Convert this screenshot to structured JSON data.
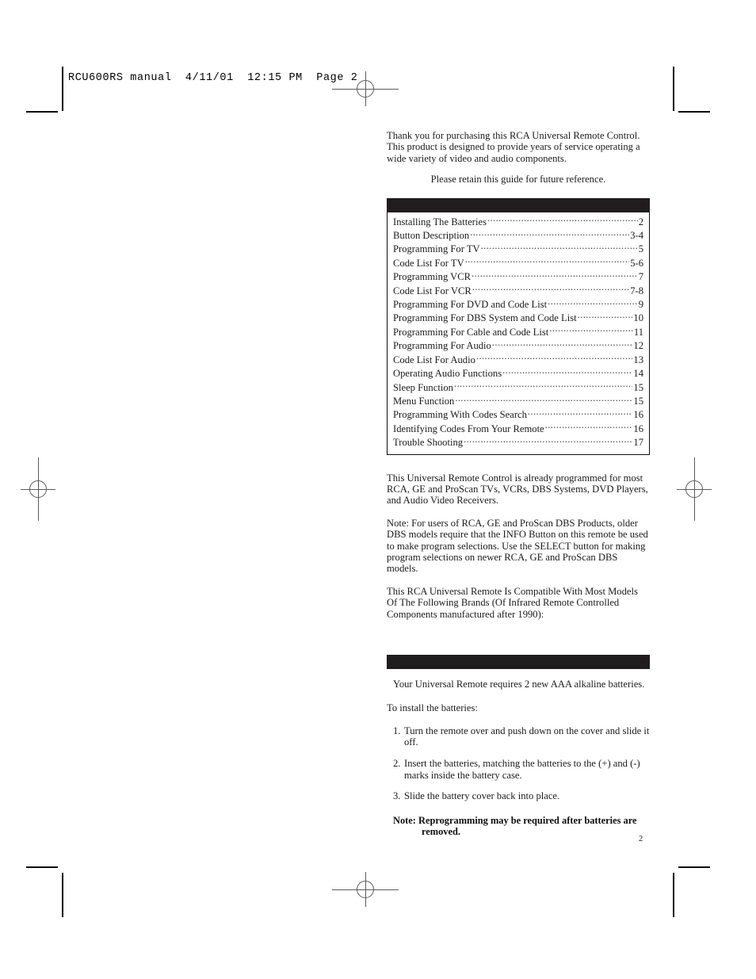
{
  "printer_slug": "RCU600RS manual  4/11/01  12:15 PM  Page 2",
  "intro": {
    "paragraph": "Thank you for purchasing this RCA Universal Remote Control. This product is designed to provide years of service operating a wide variety of video and audio components.",
    "retain_note": "Please retain this guide for future reference."
  },
  "contents": {
    "banner_label": "",
    "entries": [
      {
        "label": "Installing The Batteries",
        "page": "2"
      },
      {
        "label": "Button Description ",
        "page": "3-4"
      },
      {
        "label": "Programming For TV ",
        "page": "5"
      },
      {
        "label": "Code List For TV ",
        "page": "5-6"
      },
      {
        "label": "Programming VCR  ",
        "page": "7"
      },
      {
        "label": "Code List For VCR  ",
        "page": "7-8"
      },
      {
        "label": "Programming For DVD and Code List ",
        "page": "9"
      },
      {
        "label": "Programming For DBS System and Code List",
        "page": "10"
      },
      {
        "label": "Programming For Cable and Code List",
        "page": "11"
      },
      {
        "label": "Programming For Audio ",
        "page": "12"
      },
      {
        "label": "Code List For Audio",
        "page": "13"
      },
      {
        "label": "Operating Audio Functions",
        "page": "14"
      },
      {
        "label": "Sleep Function ",
        "page": "15"
      },
      {
        "label": "Menu Function  ",
        "page": "15"
      },
      {
        "label": "Programming With Codes Search  ",
        "page": "16"
      },
      {
        "label": "Identifying Codes From Your Remote",
        "page": "16"
      },
      {
        "label": "Trouble Shooting ",
        "page": "17"
      }
    ]
  },
  "preprogrammed": {
    "paragraph": "This Universal Remote Control is already programmed for most RCA, GE and ProScan TVs, VCRs, DBS Systems, DVD Players, and Audio Video Receivers."
  },
  "dbs_note": {
    "paragraph": "Note: For users of RCA, GE and ProScan DBS Products, older DBS models require that the INFO Button on this remote be used to make program selections. Use the SELECT button for making program selections on newer RCA, GE and ProScan DBS models."
  },
  "compatibility": {
    "paragraph": "This RCA Universal Remote Is Compatible With Most Models Of The Following Brands (Of Infrared Remote Controlled Components manufactured after 1990):"
  },
  "batteries": {
    "banner_label": "",
    "requirement": "Your Universal Remote requires 2 new AAA alkaline batteries.",
    "lead_in": "To install the batteries:",
    "steps": [
      {
        "num": "1.",
        "text": "Turn the remote over and push down on the cover and slide it off."
      },
      {
        "num": "2.",
        "text": "Insert the batteries, matching the batteries to the (+) and (-) marks inside the battery case."
      },
      {
        "num": "3.",
        "text": "Slide the battery cover back into place."
      }
    ],
    "note_line1": "Note: Reprogramming may be required after batteries are",
    "note_line2": "removed."
  },
  "folio": "2"
}
